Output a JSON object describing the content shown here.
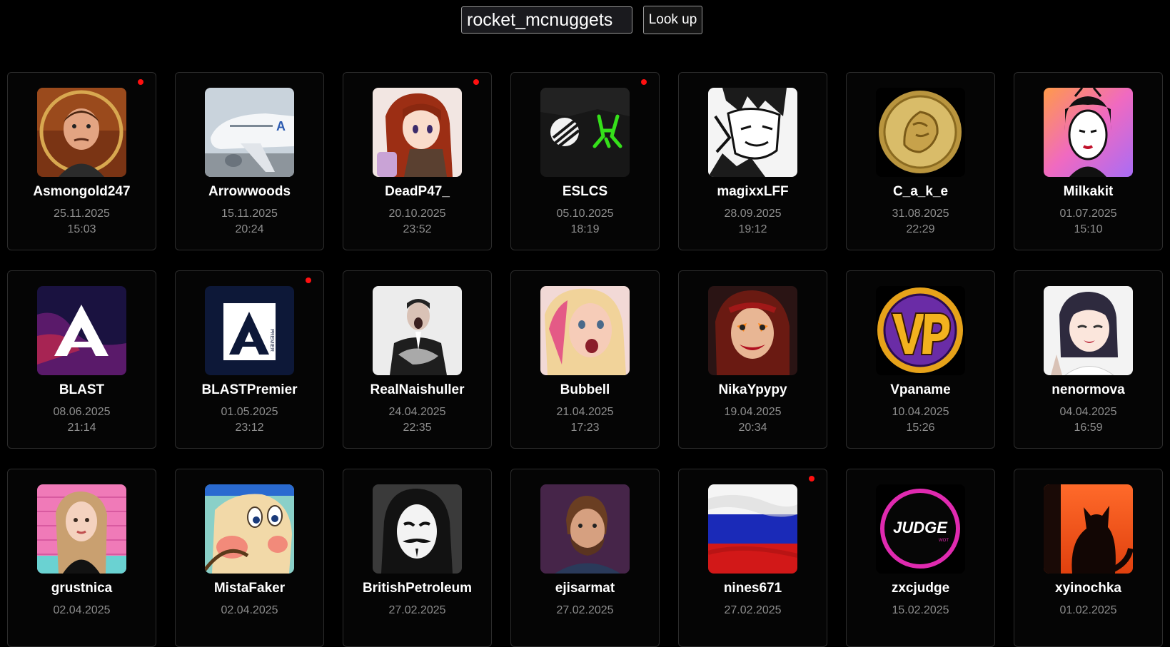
{
  "search": {
    "value": "rocket_mcnuggets",
    "button_label": "Look up"
  },
  "cards": [
    {
      "name": "Asmongold247",
      "date": "25.11.2025",
      "time": "15:03",
      "live": true,
      "avatar": "avatar-asmongold"
    },
    {
      "name": "Arrowwoods",
      "date": "15.11.2025",
      "time": "20:24",
      "live": false,
      "avatar": "avatar-airplane"
    },
    {
      "name": "DeadP47_",
      "date": "20.10.2025",
      "time": "23:52",
      "live": true,
      "avatar": "avatar-anime-red-hair"
    },
    {
      "name": "ESLCS",
      "date": "05.10.2025",
      "time": "18:19",
      "live": true,
      "avatar": "avatar-esl-logo"
    },
    {
      "name": "magixxLFF",
      "date": "28.09.2025",
      "time": "19:12",
      "live": false,
      "avatar": "avatar-manga-sketch"
    },
    {
      "name": "C_a_k_e",
      "date": "31.08.2025",
      "time": "22:29",
      "live": false,
      "avatar": "avatar-gold-coin"
    },
    {
      "name": "Milkakit",
      "date": "01.07.2025",
      "time": "15:10",
      "live": false,
      "avatar": "avatar-geisha"
    },
    {
      "name": "BLAST",
      "date": "08.06.2025",
      "time": "21:14",
      "live": false,
      "avatar": "avatar-blast-logo"
    },
    {
      "name": "BLASTPremier",
      "date": "01.05.2025",
      "time": "23:12",
      "live": true,
      "avatar": "avatar-blast-premier-logo"
    },
    {
      "name": "RealNaishuller",
      "date": "24.04.2025",
      "time": "22:35",
      "live": false,
      "avatar": "avatar-man-suit"
    },
    {
      "name": "Bubbell",
      "date": "21.04.2025",
      "time": "17:23",
      "live": false,
      "avatar": "avatar-blonde-girl"
    },
    {
      "name": "NikaYpypy",
      "date": "19.04.2025",
      "time": "20:34",
      "live": false,
      "avatar": "avatar-clown-girl"
    },
    {
      "name": "Vpaname",
      "date": "10.04.2025",
      "time": "15:26",
      "live": false,
      "avatar": "avatar-vp-logo"
    },
    {
      "name": "nenormova",
      "date": "04.04.2025",
      "time": "16:59",
      "live": false,
      "avatar": "avatar-anime-girl"
    },
    {
      "name": "grustnica",
      "date": "02.04.2025",
      "time": "",
      "live": false,
      "avatar": "avatar-girl-pink-wall"
    },
    {
      "name": "MistaFaker",
      "date": "02.04.2025",
      "time": "",
      "live": false,
      "avatar": "avatar-cartoon-pig"
    },
    {
      "name": "BritishPetroleum",
      "date": "27.02.2025",
      "time": "",
      "live": false,
      "avatar": "avatar-anonymous-mask"
    },
    {
      "name": "ejisarmat",
      "date": "27.02.2025",
      "time": "",
      "live": false,
      "avatar": "avatar-bearded-man"
    },
    {
      "name": "nines671",
      "date": "27.02.2025",
      "time": "",
      "live": true,
      "avatar": "avatar-russian-flag"
    },
    {
      "name": "zxcjudge",
      "date": "15.02.2025",
      "time": "",
      "live": false,
      "avatar": "avatar-judge-logo"
    },
    {
      "name": "xyinochka",
      "date": "01.02.2025",
      "time": "",
      "live": false,
      "avatar": "avatar-cat-silhouette"
    }
  ],
  "colors": {
    "background": "#000000",
    "live_dot": "#ff1010",
    "card_border": "#2c2c2c",
    "muted_text": "#8e8e8e"
  }
}
